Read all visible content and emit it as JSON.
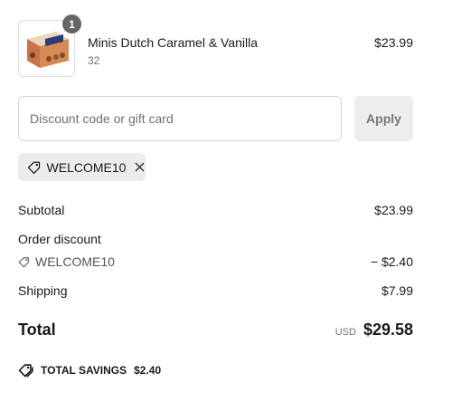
{
  "cart": {
    "items": [
      {
        "name": "Minis Dutch Caramel & Vanilla",
        "variant": "32",
        "price": "$23.99",
        "quantity": "1",
        "image_icon": "product-box-image"
      }
    ]
  },
  "discount": {
    "placeholder": "Discount code or gift card",
    "value": "",
    "apply_label": "Apply",
    "applied_code": "WELCOME10"
  },
  "summary": {
    "subtotal_label": "Subtotal",
    "subtotal_value": "$23.99",
    "order_discount_label": "Order discount",
    "discount_code": "WELCOME10",
    "discount_value": "− $2.40",
    "shipping_label": "Shipping",
    "shipping_value": "$7.99",
    "total_label": "Total",
    "currency": "USD",
    "total_value": "$29.58",
    "savings_label": "TOTAL SAVINGS",
    "savings_value": "$2.40"
  },
  "icons": {
    "tag": "tag-icon",
    "remove": "close-icon",
    "savings": "tags-icon"
  },
  "colors": {
    "badge": "#666666",
    "chip_bg": "#ececec",
    "apply_bg": "#ededed"
  }
}
